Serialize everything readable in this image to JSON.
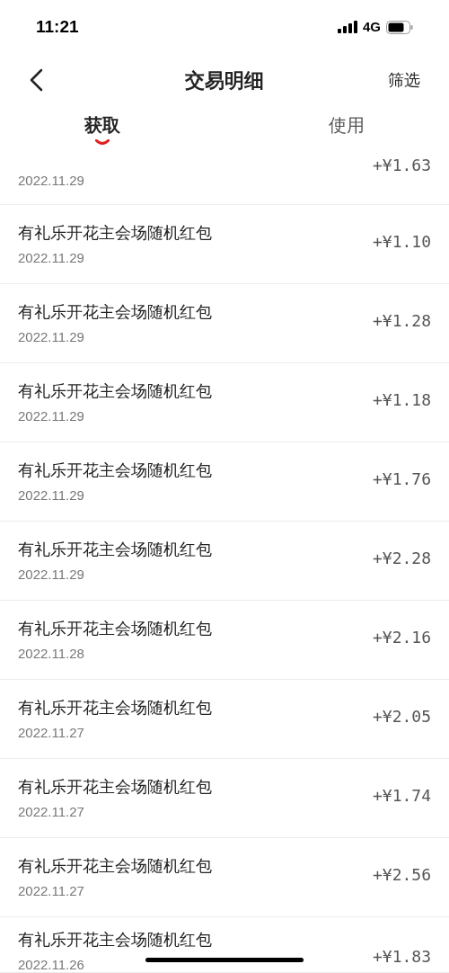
{
  "status_bar": {
    "time": "11:21",
    "network": "4G"
  },
  "nav": {
    "title": "交易明细",
    "action": "筛选"
  },
  "tabs": [
    {
      "label": "获取",
      "selected": true
    },
    {
      "label": "使用",
      "selected": false
    }
  ],
  "rows": [
    {
      "amount": "+¥1.63",
      "date": "2022.11.29"
    },
    {
      "title": "有礼乐开花主会场随机红包",
      "amount": "+¥1.10",
      "date": "2022.11.29"
    },
    {
      "title": "有礼乐开花主会场随机红包",
      "amount": "+¥1.28",
      "date": "2022.11.29"
    },
    {
      "title": "有礼乐开花主会场随机红包",
      "amount": "+¥1.18",
      "date": "2022.11.29"
    },
    {
      "title": "有礼乐开花主会场随机红包",
      "amount": "+¥1.76",
      "date": "2022.11.29"
    },
    {
      "title": "有礼乐开花主会场随机红包",
      "amount": "+¥2.28",
      "date": "2022.11.29"
    },
    {
      "title": "有礼乐开花主会场随机红包",
      "amount": "+¥2.16",
      "date": "2022.11.28"
    },
    {
      "title": "有礼乐开花主会场随机红包",
      "amount": "+¥2.05",
      "date": "2022.11.27"
    },
    {
      "title": "有礼乐开花主会场随机红包",
      "amount": "+¥1.74",
      "date": "2022.11.27"
    },
    {
      "title": "有礼乐开花主会场随机红包",
      "amount": "+¥2.56",
      "date": "2022.11.27"
    },
    {
      "title": "有礼乐开花主会场随机红包",
      "amount": "+¥1.83",
      "date": "2022.11.26"
    }
  ]
}
